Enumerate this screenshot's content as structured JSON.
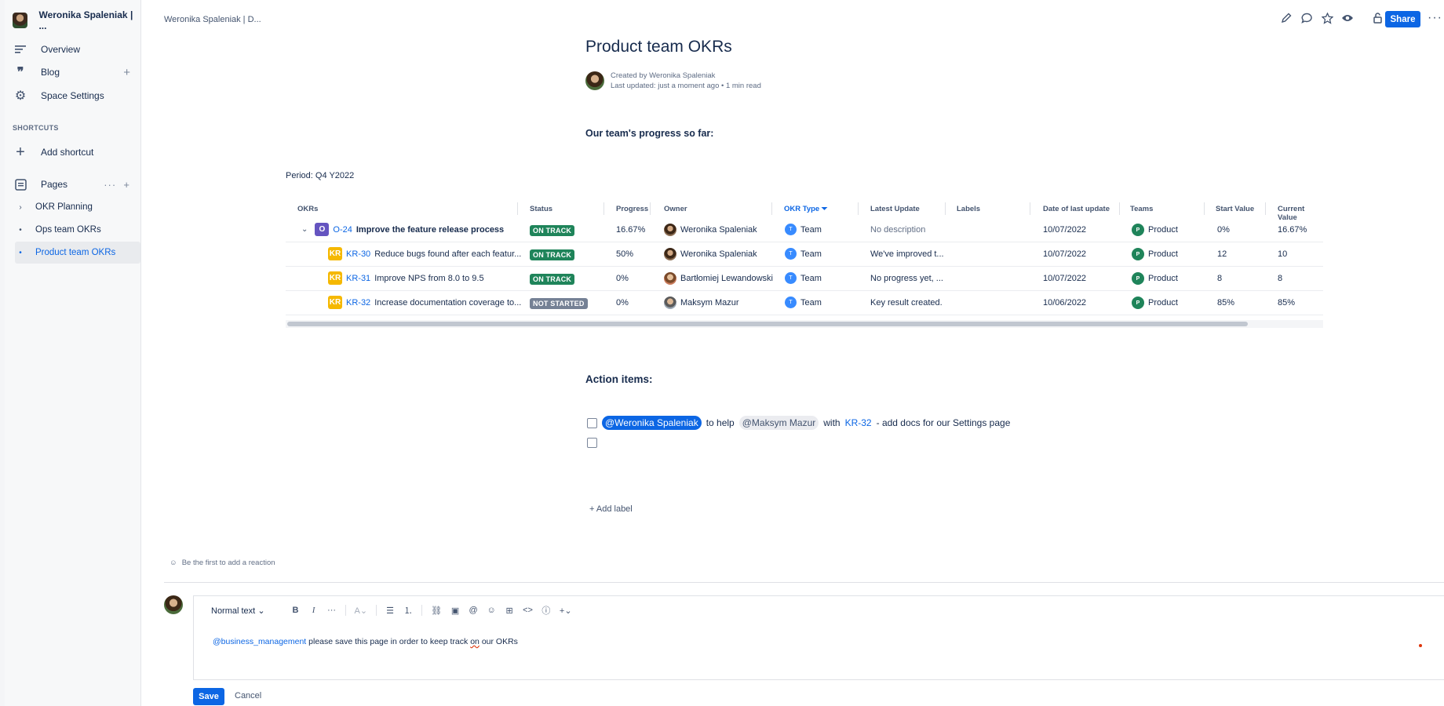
{
  "sidebar": {
    "space_name": "Weronika Spaleniak | ...",
    "nav": [
      {
        "label": "Overview",
        "icon": "overview-icon"
      },
      {
        "label": "Blog",
        "icon": "quote-icon"
      },
      {
        "label": "Space Settings",
        "icon": "gear-icon"
      }
    ],
    "shortcuts_title": "SHORTCUTS",
    "add_shortcut": "Add shortcut",
    "pages_label": "Pages",
    "pages": [
      {
        "label": "OKR Planning",
        "bullet": "›"
      },
      {
        "label": "Ops team OKRs",
        "bullet": "•"
      },
      {
        "label": "Product team OKRs",
        "bullet": "•"
      }
    ]
  },
  "header": {
    "breadcrumb": "Weronika Spaleniak | D...",
    "share_label": "Share",
    "icons": [
      "edit-icon",
      "comment-icon",
      "star-icon",
      "watch-icon",
      "restrictions-icon"
    ]
  },
  "page": {
    "title": "Product team OKRs",
    "created_by": "Created by Weronika Spaleniak",
    "last_updated": "Last updated: just a moment ago • 1 min read",
    "progress_heading": "Our team's progress so far:",
    "period": "Period: Q4 Y2022"
  },
  "table": {
    "headers": [
      "OKRs",
      "Status",
      "Progress",
      "Owner",
      "OKR Type",
      "Latest Update",
      "Labels",
      "Date of last update",
      "Teams",
      "Start Value",
      "Current Value"
    ],
    "rows": [
      {
        "type": "O",
        "key": "O-24",
        "title": "Improve the feature release process",
        "status": "ON TRACK",
        "progress": "16.67%",
        "owner": "Weronika Spaleniak",
        "okr_type": "Team",
        "latest_update": "No description",
        "labels": "",
        "date": "10/07/2022",
        "team": "Product",
        "start": "0%",
        "current": "16.67%"
      },
      {
        "type": "KR",
        "key": "KR-30",
        "title": "Reduce bugs found after each featur...",
        "status": "ON TRACK",
        "progress": "50%",
        "owner": "Weronika Spaleniak",
        "okr_type": "Team",
        "latest_update": "We've improved t...",
        "labels": "",
        "date": "10/07/2022",
        "team": "Product",
        "start": "12",
        "current": "10"
      },
      {
        "type": "KR",
        "key": "KR-31",
        "title": "Improve NPS from 8.0 to 9.5",
        "status": "ON TRACK",
        "progress": "0%",
        "owner": "Bartłomiej Lewandowski",
        "okr_type": "Team",
        "latest_update": "No progress yet, ...",
        "labels": "",
        "date": "10/07/2022",
        "team": "Product",
        "start": "8",
        "current": "8"
      },
      {
        "type": "KR",
        "key": "KR-32",
        "title": "Increase documentation coverage to...",
        "status": "NOT STARTED",
        "progress": "0%",
        "owner": "Maksym Mazur",
        "okr_type": "Team",
        "latest_update": "Key result created.",
        "labels": "",
        "date": "10/06/2022",
        "team": "Product",
        "start": "85%",
        "current": "85%"
      }
    ]
  },
  "actions": {
    "heading": "Action items:",
    "task1": {
      "mention_self": "@Weronika Spaleniak",
      "text1": "to help",
      "mention": "@Maksym Mazur",
      "text2": "with",
      "issue": "KR-32",
      "text3": "- add docs for our Settings page"
    },
    "add_label": "+ Add label"
  },
  "reactions": {
    "text": "Be the first to add a reaction"
  },
  "editor": {
    "text_style": "Normal text",
    "mention": "@business_management",
    "body_before": "please save this page in order to keep track",
    "body_spell": "on",
    "body_after": "our OKRs",
    "save_label": "Save",
    "cancel_label": "Cancel"
  },
  "colors": {
    "accent": "#0c66e4",
    "on_track": "#1f845a",
    "not_started": "#758195",
    "objective": "#6554c0",
    "key_result": "#f5b800"
  }
}
